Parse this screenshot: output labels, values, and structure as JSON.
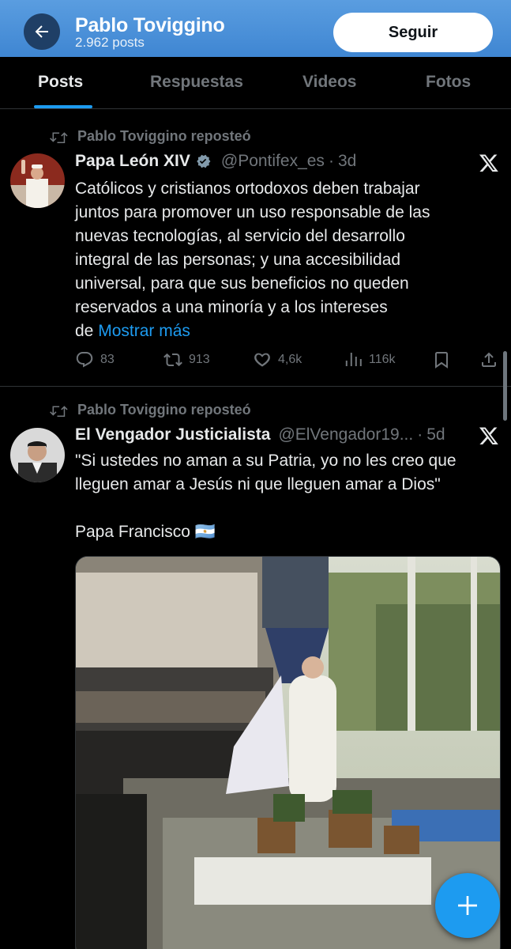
{
  "header": {
    "name": "Pablo Toviggino",
    "post_count": "2.962 posts",
    "follow_label": "Seguir"
  },
  "tabs": [
    {
      "label": "Posts",
      "active": true
    },
    {
      "label": "Respuestas",
      "active": false
    },
    {
      "label": "Videos",
      "active": false
    },
    {
      "label": "Fotos",
      "active": false
    }
  ],
  "posts": [
    {
      "repost_text": "Pablo Toviggino reposteó",
      "author": "Papa León XIV",
      "verified": true,
      "handle": "@Pontifex_es",
      "separator": "·",
      "time": "3d",
      "lines": [
        "Católicos y cristianos ortodoxos deben trabajar",
        "juntos para promover un uso responsable de las",
        "nuevas tecnologías, al servicio del desarrollo",
        "integral de las personas; y una accesibilidad",
        "universal, para que sus beneficios no queden",
        "reservados a una minoría y a los intereses",
        "de"
      ],
      "more_label": "Mostrar más",
      "stats": {
        "replies": "83",
        "reposts": "913",
        "likes": "4,6k",
        "views": "116k"
      }
    },
    {
      "repost_text": "Pablo Toviggino reposteó",
      "author": "El Vengador Justicialista",
      "handle": "@ElVengador19...",
      "separator": "·",
      "time": "5d",
      "lines": [
        "\"Si ustedes no aman a su Patria, yo no les creo que",
        "lleguen amar a Jesús ni que lleguen amar a Dios\"",
        "",
        "Papa Francisco 🇦🇷"
      ]
    }
  ],
  "icons": {
    "back": "arrow-left-icon",
    "repost": "repost-icon",
    "verified": "verified-badge-icon",
    "x": "x-logo-icon",
    "reply": "reply-icon",
    "like": "heart-icon",
    "views": "views-icon",
    "bookmark": "bookmark-icon",
    "share": "share-icon",
    "compose": "plus-icon"
  },
  "colors": {
    "header_bg": "#4a90d9",
    "accent": "#1d9bf0",
    "muted": "#71767b",
    "text": "#e7e9ea"
  }
}
